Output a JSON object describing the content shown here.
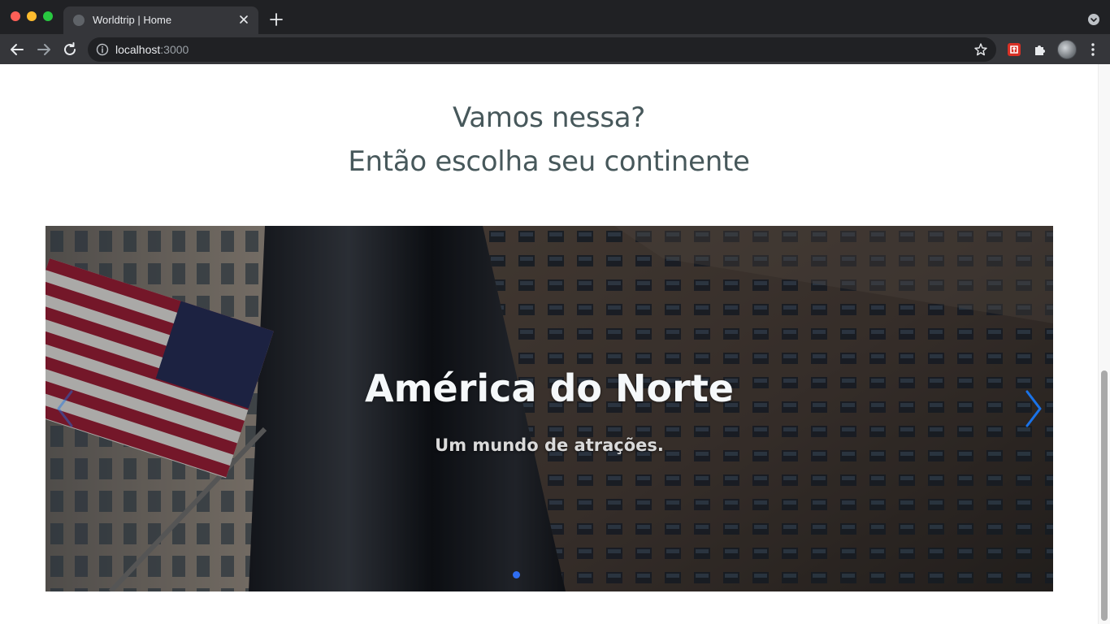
{
  "browser": {
    "tab_title": "Worldtrip | Home",
    "url_host": "localhost",
    "url_port": ":3000"
  },
  "page": {
    "heading_line1": "Vamos nessa?",
    "heading_line2": "Então escolha seu continente"
  },
  "carousel": {
    "active_index": 0,
    "slides": [
      {
        "title": "América do Norte",
        "subtitle": "Um mundo de atrações."
      }
    ],
    "arrow_color": "#1a73e8",
    "dot_color": "#2f6ef2"
  }
}
